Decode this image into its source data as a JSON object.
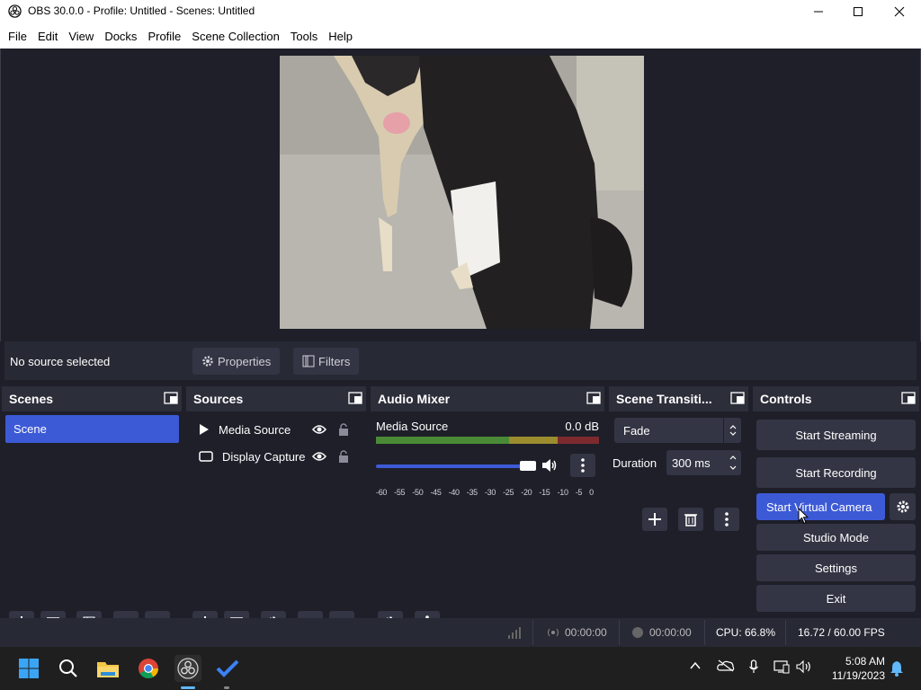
{
  "window": {
    "title": "OBS 30.0.0 - Profile: Untitled - Scenes: Untitled",
    "minimize_icon": "minimize-icon",
    "maximize_icon": "maximize-icon",
    "close_icon": "close-icon"
  },
  "menu": [
    "File",
    "Edit",
    "View",
    "Docks",
    "Profile",
    "Scene Collection",
    "Tools",
    "Help"
  ],
  "source_toolbar": {
    "status": "No source selected",
    "properties_label": "Properties",
    "filters_label": "Filters"
  },
  "scenes": {
    "title": "Scenes",
    "items": [
      "Scene"
    ],
    "selected": "Scene"
  },
  "sources": {
    "title": "Sources",
    "items": [
      {
        "name": "Media Source",
        "icon": "play-icon"
      },
      {
        "name": "Display Capture",
        "icon": "monitor-icon"
      }
    ]
  },
  "audio_mixer": {
    "title": "Audio Mixer",
    "channel": {
      "name": "Media Source",
      "level": "0.0 dB",
      "volume_fraction": 0.95
    },
    "ticks": [
      "-60",
      "-55",
      "-50",
      "-45",
      "-40",
      "-35",
      "-30",
      "-25",
      "-20",
      "-15",
      "-10",
      "-5",
      "0"
    ]
  },
  "scene_transitions": {
    "title": "Scene Transiti...",
    "transition": "Fade",
    "duration_label": "Duration",
    "duration_value": "300 ms"
  },
  "controls": {
    "title": "Controls",
    "start_streaming": "Start Streaming",
    "start_recording": "Start Recording",
    "start_virtual_camera": "Start Virtual Camera",
    "studio_mode": "Studio Mode",
    "settings": "Settings",
    "exit": "Exit"
  },
  "statusbar": {
    "stream_time": "00:00:00",
    "record_time": "00:00:00",
    "cpu": "CPU: 66.8%",
    "fps": "16.72 / 60.00 FPS"
  },
  "taskbar": {
    "time": "5:08 AM",
    "date": "11/19/2023",
    "apps": [
      "windows-start-icon",
      "search-icon",
      "file-explorer-icon",
      "chrome-icon",
      "obs-icon",
      "todo-icon"
    ]
  },
  "colors": {
    "accent": "#3d5ad6",
    "panel": "#272934",
    "background": "#1e1f29",
    "button": "#333544"
  }
}
